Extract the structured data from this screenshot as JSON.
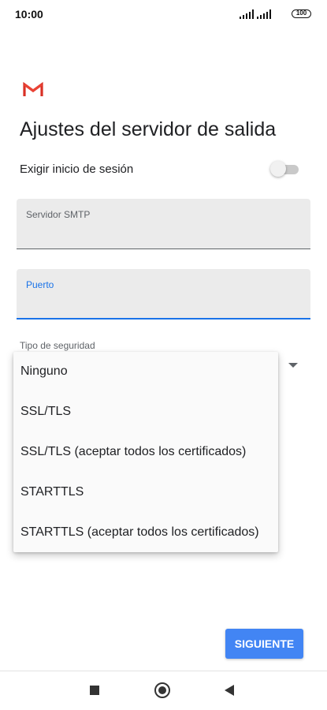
{
  "status_bar": {
    "time": "10:00",
    "battery": "100",
    "icons": [
      "signal-icon",
      "signal-icon",
      "battery-icon"
    ]
  },
  "header": {
    "logo_icon": "gmail-icon",
    "title": "Ajustes del servidor de salida"
  },
  "login": {
    "label": "Exigir inicio de sesión",
    "enabled": false
  },
  "smtp": {
    "label": "Servidor SMTP",
    "value": ""
  },
  "port": {
    "label": "Puerto",
    "value": ""
  },
  "security": {
    "label": "Tipo de seguridad",
    "options": [
      "Ninguno",
      "SSL/TLS",
      "SSL/TLS (aceptar todos los certificados)",
      "STARTTLS",
      "STARTTLS (aceptar todos los certificados)"
    ]
  },
  "footer": {
    "next_label": "SIGUIENTE"
  },
  "nav": {
    "icons": [
      "recent-apps-icon",
      "home-icon",
      "back-icon"
    ]
  },
  "colors": {
    "accent": "#1a73e8",
    "button": "#4285f4",
    "field_bg": "#ebebeb",
    "gmail_red": "#d93025"
  }
}
